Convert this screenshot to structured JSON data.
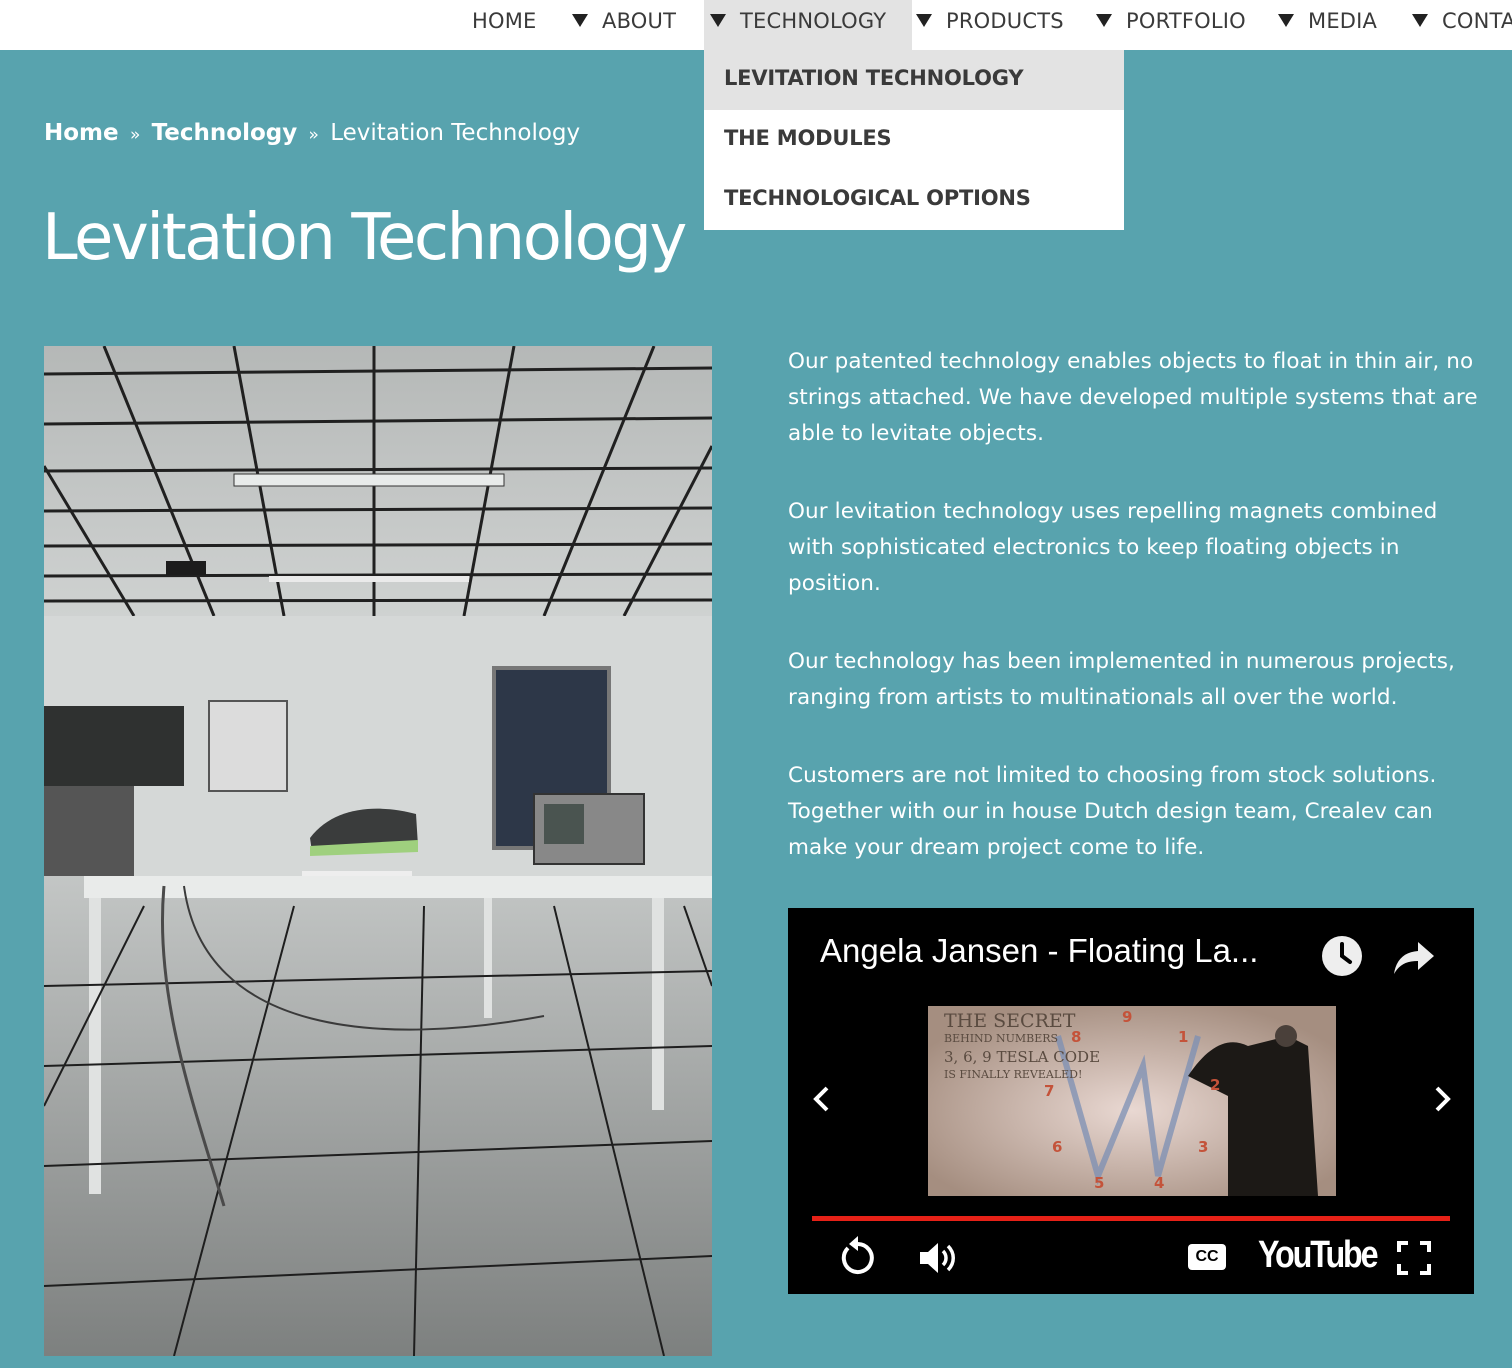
{
  "nav": {
    "items": [
      {
        "label": "HOME",
        "has_arrow": false
      },
      {
        "label": "ABOUT",
        "has_arrow": true
      },
      {
        "label": "TECHNOLOGY",
        "has_arrow": true,
        "active": true
      },
      {
        "label": "PRODUCTS",
        "has_arrow": true
      },
      {
        "label": "PORTFOLIO",
        "has_arrow": true
      },
      {
        "label": "MEDIA",
        "has_arrow": true
      },
      {
        "label": "CONTA",
        "has_arrow": true
      }
    ],
    "dropdown": [
      {
        "label": "LEVITATION TECHNOLOGY",
        "selected": true
      },
      {
        "label": "THE MODULES"
      },
      {
        "label": "TECHNOLOGICAL OPTIONS"
      }
    ]
  },
  "breadcrumb": {
    "home": "Home",
    "sep": "»",
    "section": "Technology",
    "current": "Levitation Technology"
  },
  "page": {
    "title": "Levitation Technology",
    "paragraphs": [
      "Our patented technology enables objects to float in thin air, no strings attached. We have developed multiple systems that are able to levitate objects.",
      "Our levitation technology uses repelling magnets combined with sophisticated electronics to keep floating objects in position.",
      "Our technology has been implemented in numerous projects, ranging from artists to multinationals all over the world.",
      "Customers are not limited to choosing from stock solutions. Together with our in house Dutch design team, Crealev can make your dream project come to life."
    ]
  },
  "video": {
    "title": "Angela Jansen - Floating La...",
    "thumbnail_text": {
      "line1": "THE SECRET",
      "line2": "BEHIND NUMBERS",
      "line3": "3, 6, 9 TESLA CODE",
      "line4": "IS FINALLY REVEALED!",
      "digits": [
        "9",
        "1",
        "8",
        "2",
        "7",
        "6",
        "3",
        "5",
        "4"
      ]
    },
    "logo": "YouTube",
    "cc_label": "CC",
    "progress_fraction": 1.0,
    "icons": [
      "clock-icon",
      "share-icon",
      "chevron-left-icon",
      "chevron-right-icon",
      "replay-icon",
      "volume-icon",
      "cc-icon",
      "fullscreen-icon"
    ]
  },
  "colors": {
    "background": "#58a3ae",
    "nav_active": "#e3e3e3",
    "progress": "#e62117"
  }
}
